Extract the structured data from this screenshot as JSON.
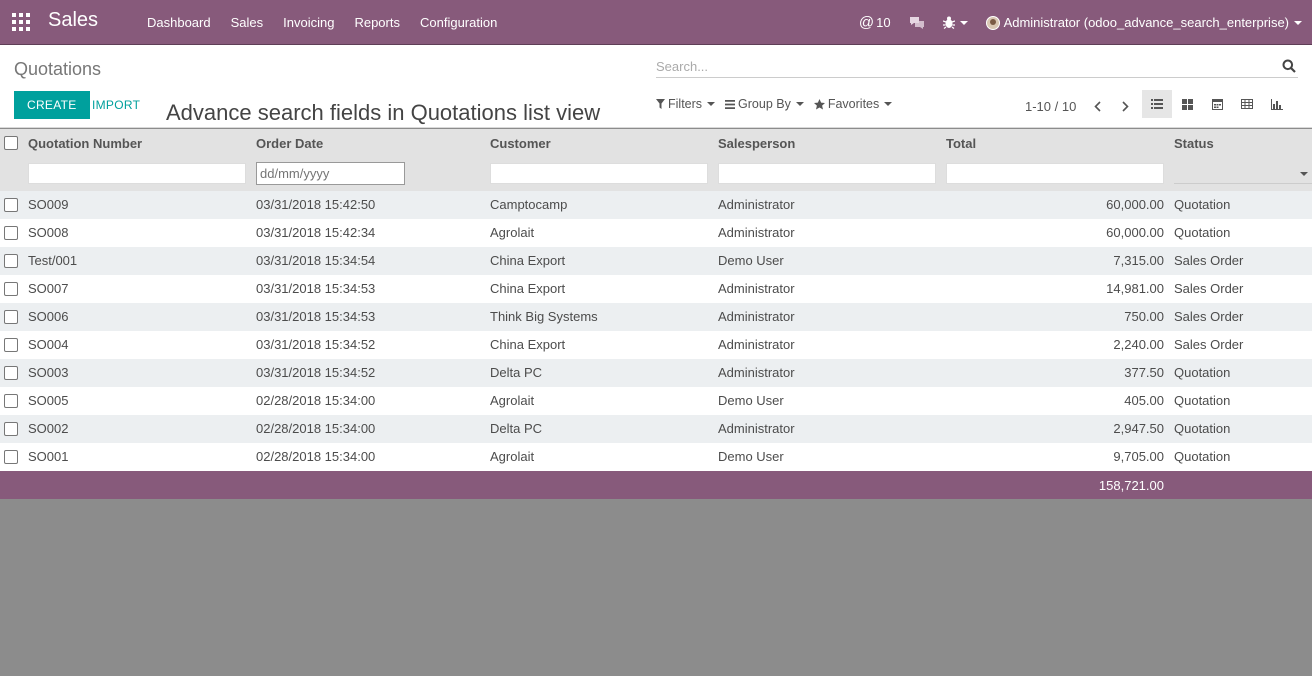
{
  "navbar": {
    "brand": "Sales",
    "menu": [
      "Dashboard",
      "Sales",
      "Invoicing",
      "Reports",
      "Configuration"
    ],
    "mentions_count": "10",
    "user_label": "Administrator (odoo_advance_search_enterprise)"
  },
  "control_panel": {
    "breadcrumb": "Quotations",
    "search_placeholder": "Search...",
    "create_label": "CREATE",
    "import_label": "IMPORT",
    "caption": "Advance search fields in Quotations list view",
    "filters_label": "Filters",
    "group_by_label": "Group By",
    "favorites_label": "Favorites",
    "pager_value": "1-10 / 10"
  },
  "list": {
    "columns": [
      "Quotation Number",
      "Order Date",
      "Customer",
      "Salesperson",
      "Total",
      "Status"
    ],
    "date_placeholder": "dd/mm/yyyy",
    "rows": [
      {
        "number": "SO009",
        "date": "03/31/2018 15:42:50",
        "customer": "Camptocamp",
        "salesperson": "Administrator",
        "total": "60,000.00",
        "status": "Quotation"
      },
      {
        "number": "SO008",
        "date": "03/31/2018 15:42:34",
        "customer": "Agrolait",
        "salesperson": "Administrator",
        "total": "60,000.00",
        "status": "Quotation"
      },
      {
        "number": "Test/001",
        "date": "03/31/2018 15:34:54",
        "customer": "China Export",
        "salesperson": "Demo User",
        "total": "7,315.00",
        "status": "Sales Order"
      },
      {
        "number": "SO007",
        "date": "03/31/2018 15:34:53",
        "customer": "China Export",
        "salesperson": "Administrator",
        "total": "14,981.00",
        "status": "Sales Order"
      },
      {
        "number": "SO006",
        "date": "03/31/2018 15:34:53",
        "customer": "Think Big Systems",
        "salesperson": "Administrator",
        "total": "750.00",
        "status": "Sales Order"
      },
      {
        "number": "SO004",
        "date": "03/31/2018 15:34:52",
        "customer": "China Export",
        "salesperson": "Administrator",
        "total": "2,240.00",
        "status": "Sales Order"
      },
      {
        "number": "SO003",
        "date": "03/31/2018 15:34:52",
        "customer": "Delta PC",
        "salesperson": "Administrator",
        "total": "377.50",
        "status": "Quotation"
      },
      {
        "number": "SO005",
        "date": "02/28/2018 15:34:00",
        "customer": "Agrolait",
        "salesperson": "Demo User",
        "total": "405.00",
        "status": "Quotation"
      },
      {
        "number": "SO002",
        "date": "02/28/2018 15:34:00",
        "customer": "Delta PC",
        "salesperson": "Administrator",
        "total": "2,947.50",
        "status": "Quotation"
      },
      {
        "number": "SO001",
        "date": "02/28/2018 15:34:00",
        "customer": "Agrolait",
        "salesperson": "Demo User",
        "total": "9,705.00",
        "status": "Quotation"
      }
    ],
    "footer_total": "158,721.00"
  },
  "colors": {
    "navbar": "#875a7b",
    "primary_button": "#00a09d",
    "row_alt": "#eceff1",
    "header": "#e2e2e2",
    "backdrop": "#8c8c8c"
  }
}
